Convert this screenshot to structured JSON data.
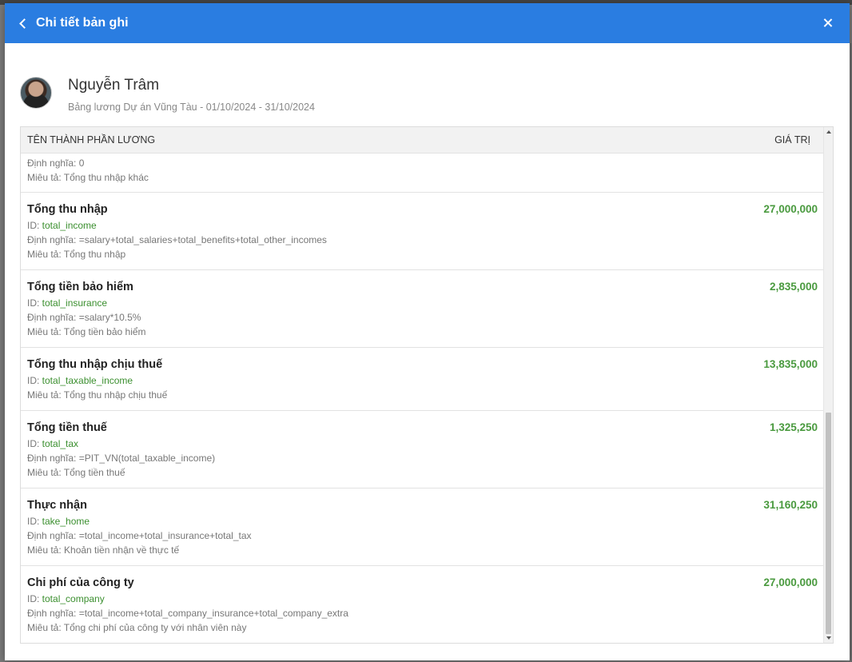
{
  "modal": {
    "title": "Chi tiết bản ghi",
    "back_icon": "chevron-left-icon",
    "close_icon": "close-icon",
    "header_color": "#2a7de1"
  },
  "profile": {
    "name": "Nguyễn Trâm",
    "subtitle": "Bảng lương Dự án Vũng Tàu - 01/10/2024 - 31/10/2024"
  },
  "table": {
    "columns": {
      "name": "TÊN THÀNH PHẦN LƯƠNG",
      "value": "GIÁ TRỊ"
    },
    "partial_row": {
      "definition": "Định nghĩa: 0",
      "description": "Miêu tả: Tổng thu nhập khác"
    },
    "id_prefix": "ID: ",
    "rows": [
      {
        "title": "Tổng thu nhập",
        "value": "27,000,000",
        "id": "total_income",
        "definition": "Định nghĩa: =salary+total_salaries+total_benefits+total_other_incomes",
        "description": "Miêu tả: Tổng thu nhập"
      },
      {
        "title": "Tổng tiền bảo hiểm",
        "value": "2,835,000",
        "id": "total_insurance",
        "definition": "Định nghĩa: =salary*10.5%",
        "description": "Miêu tả: Tổng tiền bảo hiểm"
      },
      {
        "title": "Tổng thu nhập chịu thuế",
        "value": "13,835,000",
        "id": "total_taxable_income",
        "description": "Miêu tả: Tổng thu nhập chịu thuế"
      },
      {
        "title": "Tổng tiền thuế",
        "value": "1,325,250",
        "id": "total_tax",
        "definition": "Định nghĩa: =PIT_VN(total_taxable_income)",
        "description": "Miêu tả: Tổng tiền thuế"
      },
      {
        "title": "Thực nhận",
        "value": "31,160,250",
        "id": "take_home",
        "definition": "Định nghĩa: =total_income+total_insurance+total_tax",
        "description": "Miêu tả: Khoản tiền nhận về thực tế"
      },
      {
        "title": "Chi phí của công ty",
        "value": "27,000,000",
        "id": "total_company",
        "definition": "Định nghĩa: =total_income+total_company_insurance+total_company_extra",
        "description": "Miêu tả: Tổng chi phí của công ty với nhân viên này"
      }
    ],
    "value_color": "#4a9a3f"
  }
}
